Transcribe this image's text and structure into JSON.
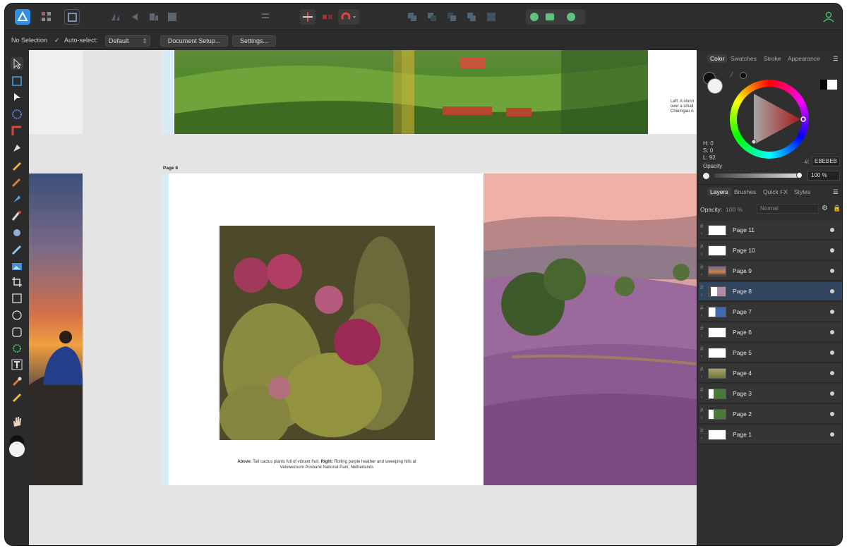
{
  "context_bar": {
    "selection": "No Selection",
    "auto_select_label": "Auto-select:",
    "auto_select_value": "Default",
    "document_setup": "Document Setup...",
    "settings": "Settings..."
  },
  "canvas": {
    "page_label": "Page 8",
    "top_caption": "Left: A stunn over a small Chiemgau A",
    "caption_lead": "Above:",
    "caption_mid": " Tall cactus plants full of vibrant fruit. ",
    "caption_lead2": "Right:",
    "caption_tail": " Rolling purple heather and sweeping hills at Veluwezoom Posbank National Park, Netherlands"
  },
  "color_panel": {
    "tabs": [
      "Color",
      "Swatches",
      "Stroke",
      "Appearance"
    ],
    "h": "H: 0",
    "s": "S: 0",
    "l": "L: 92",
    "hex_label": "#:",
    "hex_value": "EBEBEB",
    "opacity_label": "Opacity",
    "opacity_value": "100 %"
  },
  "layers_panel": {
    "tabs": [
      "Layers",
      "Brushes",
      "Quick FX",
      "Styles"
    ],
    "opacity_label": "Opacity:",
    "opacity_value": "100 %",
    "blend_mode": "Normal",
    "layers": [
      {
        "name": "Page 11",
        "thumb": "blank"
      },
      {
        "name": "Page 10",
        "thumb": "blank"
      },
      {
        "name": "Page 9",
        "thumb": "sunset"
      },
      {
        "name": "Page 8",
        "thumb": "cactus",
        "selected": true
      },
      {
        "name": "Page 7",
        "thumb": "blue"
      },
      {
        "name": "Page 6",
        "thumb": "blank"
      },
      {
        "name": "Page 5",
        "thumb": "blank"
      },
      {
        "name": "Page 4",
        "thumb": "landscape"
      },
      {
        "name": "Page 3",
        "thumb": "green"
      },
      {
        "name": "Page 2",
        "thumb": "green"
      },
      {
        "name": "Page 1",
        "thumb": "blank"
      }
    ]
  },
  "colors": {
    "accent": "#2f8ee6",
    "selected_row": "#31455f",
    "user_icon": "#3fbf6a"
  }
}
